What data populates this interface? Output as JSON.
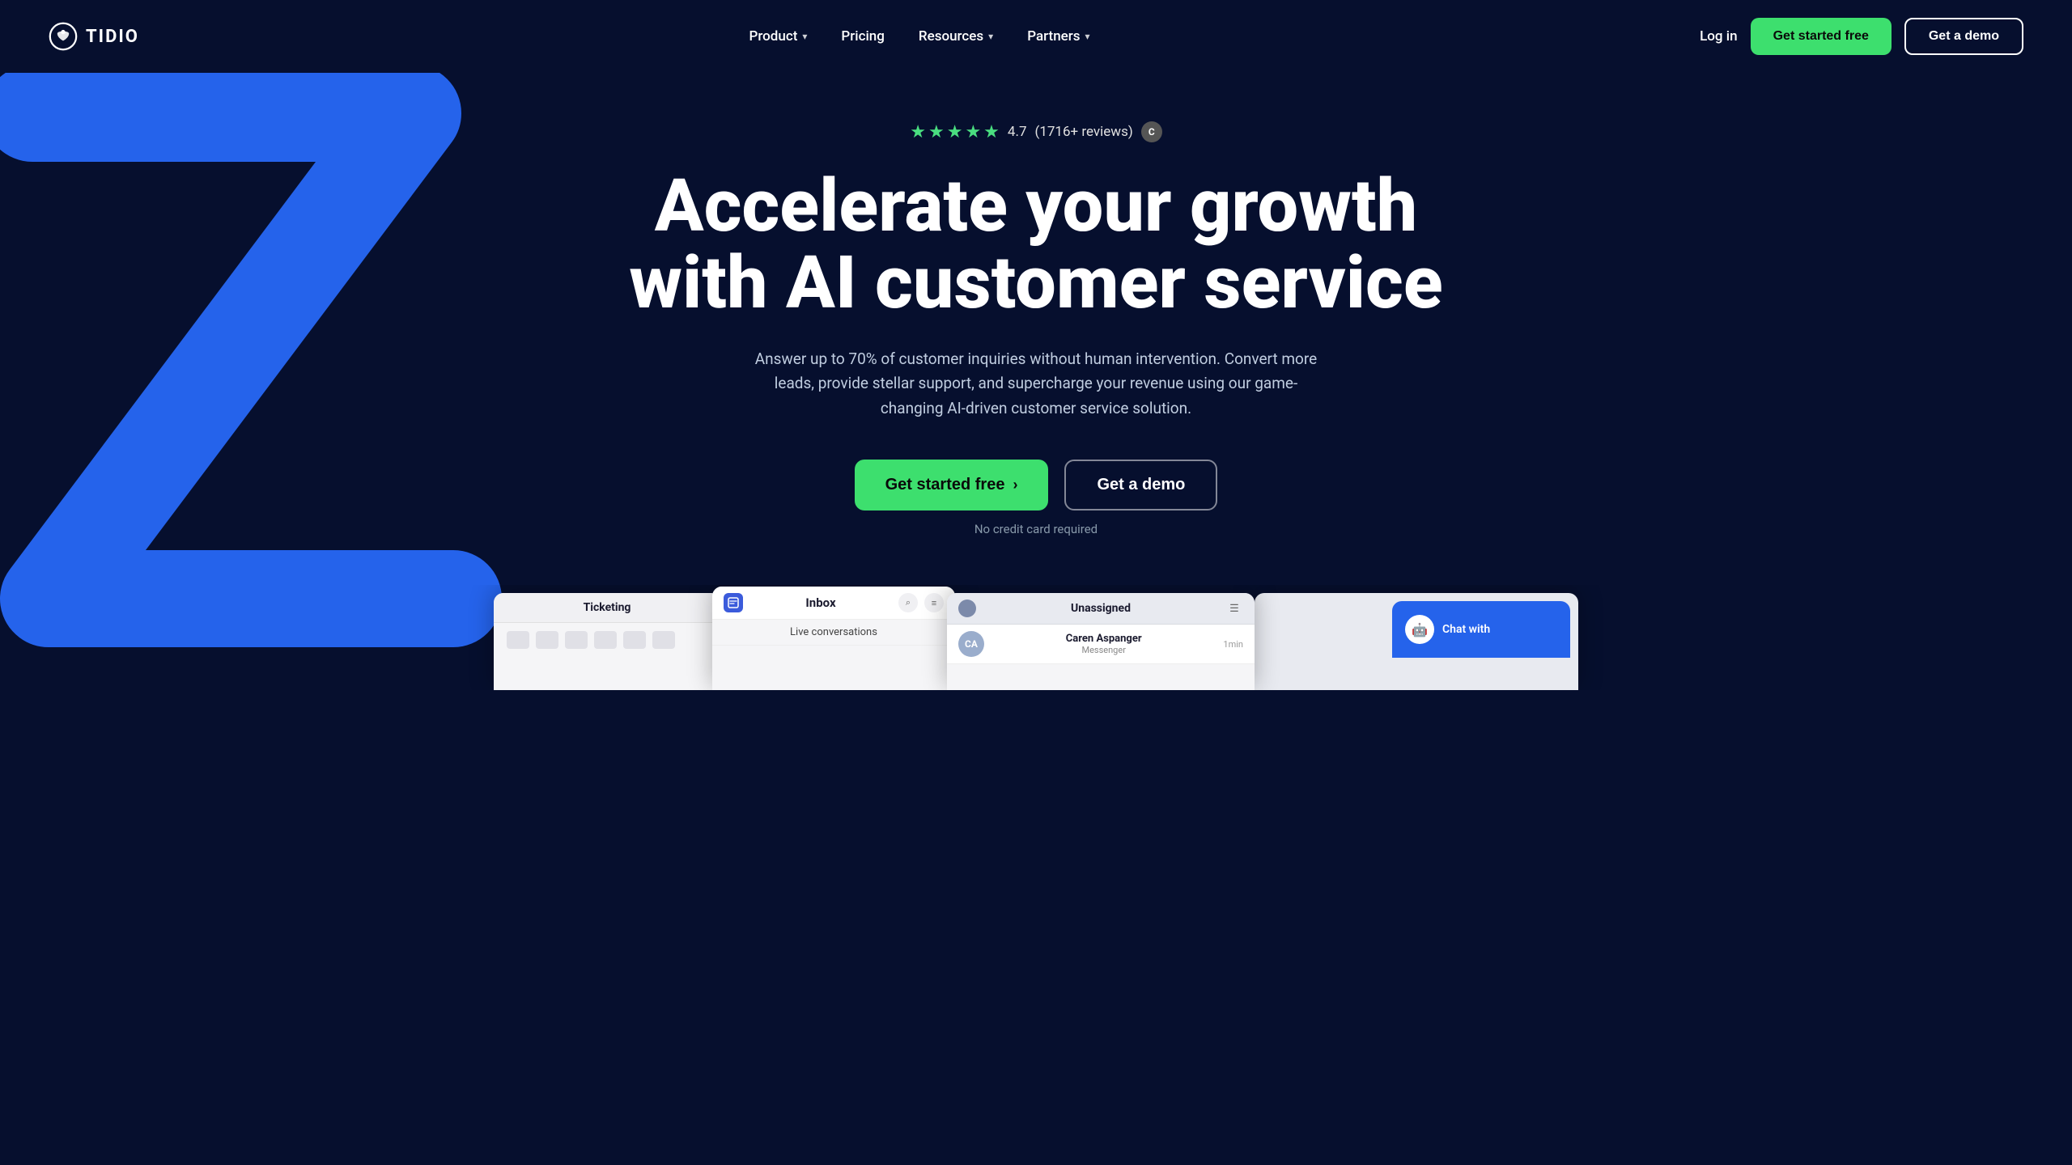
{
  "nav": {
    "logo_text": "TIDIO",
    "links": [
      {
        "label": "Product",
        "has_dropdown": true
      },
      {
        "label": "Pricing",
        "has_dropdown": false
      },
      {
        "label": "Resources",
        "has_dropdown": true
      },
      {
        "label": "Partners",
        "has_dropdown": true
      }
    ],
    "login_label": "Log in",
    "cta_primary": "Get started free",
    "cta_demo": "Get a demo"
  },
  "hero": {
    "review_score": "4.7",
    "review_count": "(1716+ reviews)",
    "title_line1": "Accelerate your growth",
    "title_line2": "with AI customer service",
    "subtitle": "Answer up to 70% of customer inquiries without human intervention. Convert more leads, provide stellar support, and supercharge your revenue using our game-changing AI-driven customer service solution.",
    "cta_primary": "Get started free",
    "cta_demo": "Get a demo",
    "no_credit": "No credit card required"
  },
  "preview": {
    "ticketing_title": "Ticketing",
    "inbox_title": "Inbox",
    "live_conversations": "Live conversations",
    "unassigned_title": "Unassigned",
    "chat_user_name": "Caren Aspanger",
    "chat_channel": "Messenger",
    "chat_time": "1min",
    "chat_widget_label": "Chat with"
  }
}
